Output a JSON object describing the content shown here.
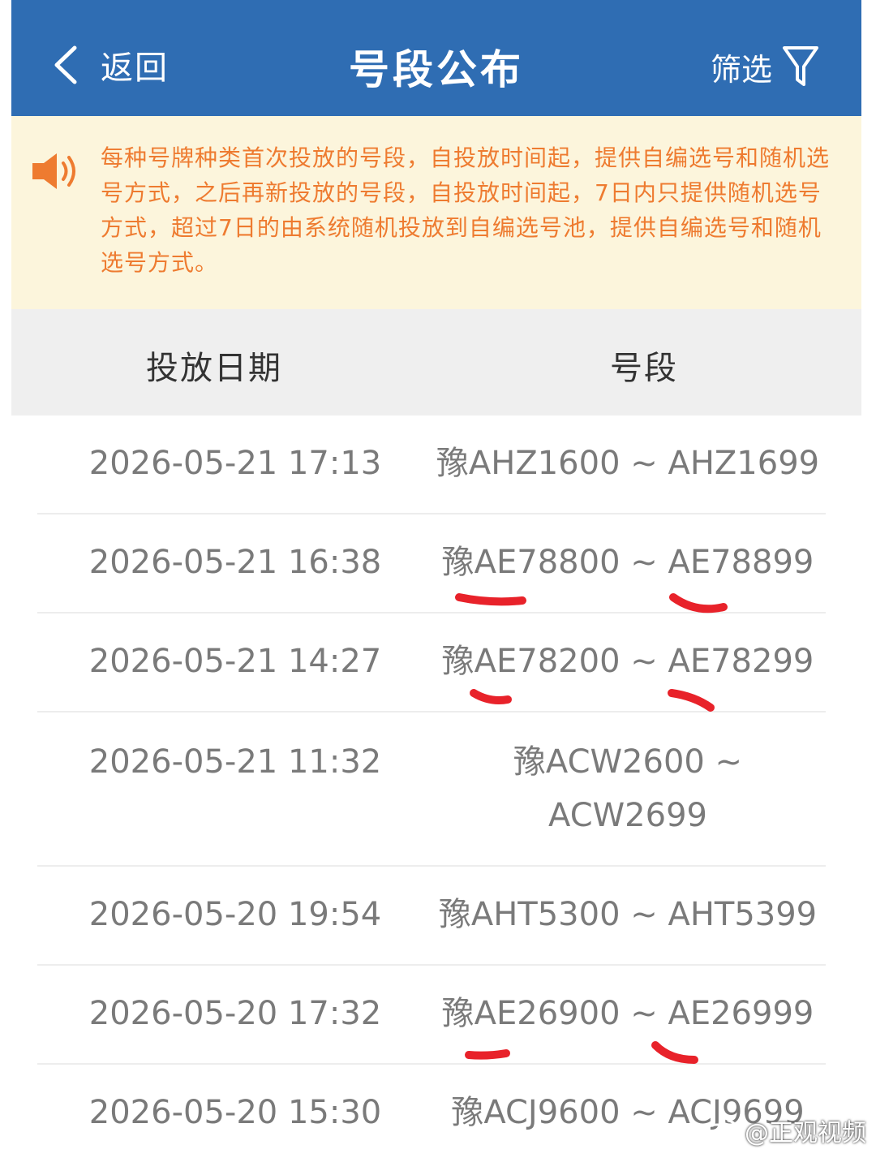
{
  "header": {
    "back_label": "返回",
    "title": "号段公布",
    "filter_label": "筛选"
  },
  "notice": {
    "text": "每种号牌种类首次投放的号段，自投放时间起，提供自编选号和随机选号方式，之后再新投放的号段，自投放时间起，7日内只提供随机选号方式，超过7日的由系统随机投放到自编选号池，提供自编选号和随机选号方式。"
  },
  "table": {
    "headers": [
      "投放日期",
      "号段"
    ],
    "rows": [
      {
        "date": "2026-05-21 17:13",
        "segment": "豫AHZ1600 ~ AHZ1699"
      },
      {
        "date": "2026-05-21 16:38",
        "segment": "豫AE78800 ~ AE78899"
      },
      {
        "date": "2026-05-21 14:27",
        "segment": "豫AE78200 ~ AE78299"
      },
      {
        "date": "2026-05-21 11:32",
        "segment_line1": "豫ACW2600 ~",
        "segment_line2": "ACW2699"
      },
      {
        "date": "2026-05-20 19:54",
        "segment": "豫AHT5300 ~ AHT5399"
      },
      {
        "date": "2026-05-20 17:32",
        "segment": "豫AE26900 ~ AE26999"
      },
      {
        "date": "2026-05-20 15:30",
        "segment": "豫ACJ9600 ~ ACJ9699"
      }
    ]
  },
  "watermark": "@正观视频",
  "colors": {
    "header_bg": "#2f6db3",
    "notice_bg": "#fcf5dc",
    "notice_text": "#ee7b30",
    "annotation": "#e8222a"
  }
}
